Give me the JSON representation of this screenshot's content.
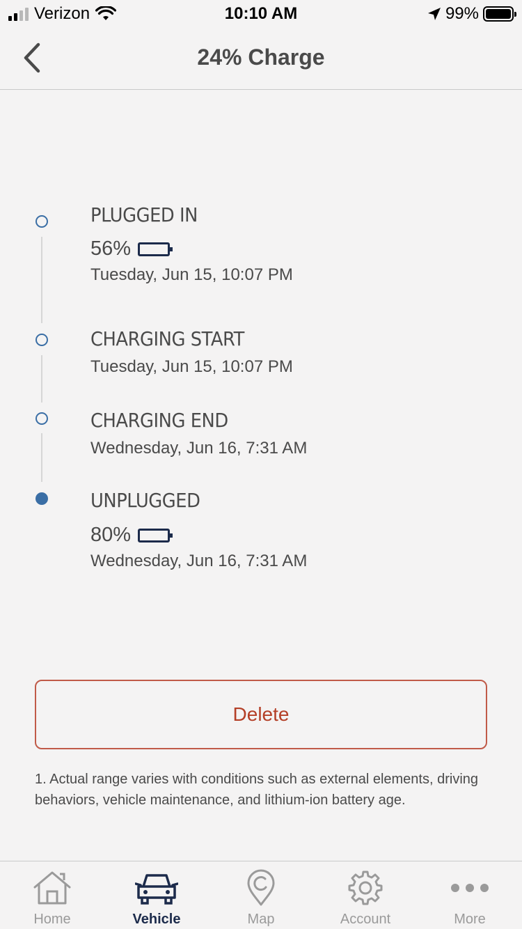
{
  "status_bar": {
    "carrier": "Verizon",
    "time": "10:10 AM",
    "battery_pct": "99%"
  },
  "header": {
    "title": "24% Charge"
  },
  "timeline": [
    {
      "title": "PLUGGED IN",
      "battery": "56%",
      "battery_level": 0.56,
      "date": "Tuesday, Jun 15, 10:07 PM"
    },
    {
      "title": "CHARGING START",
      "date": "Tuesday, Jun 15, 10:07 PM"
    },
    {
      "title": "CHARGING END",
      "date": "Wednesday, Jun 16, 7:31 AM"
    },
    {
      "title": "UNPLUGGED",
      "battery": "80%",
      "battery_level": 0.8,
      "date": "Wednesday, Jun 16, 7:31 AM"
    }
  ],
  "delete_label": "Delete",
  "footnote": "1. Actual range varies with conditions such as external elements, driving behaviors, vehicle maintenance, and lithium-ion battery age.",
  "tabs": [
    {
      "label": "Home",
      "icon": "home-icon"
    },
    {
      "label": "Vehicle",
      "icon": "vehicle-icon",
      "active": true
    },
    {
      "label": "Map",
      "icon": "map-pin-icon"
    },
    {
      "label": "Account",
      "icon": "gear-icon"
    },
    {
      "label": "More",
      "icon": "more-icon"
    }
  ],
  "colors": {
    "accent": "#3a6ea5",
    "navy": "#1c2b4b",
    "delete": "#b43f27"
  }
}
